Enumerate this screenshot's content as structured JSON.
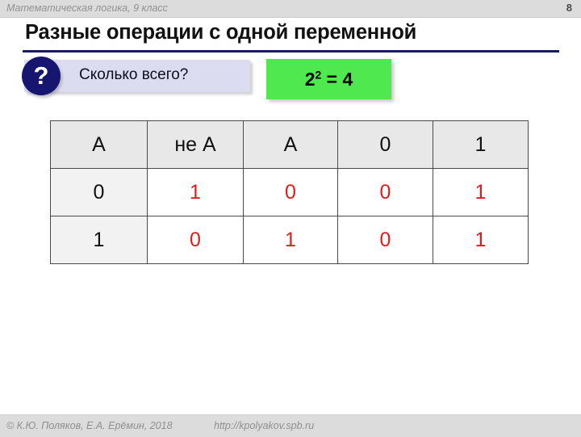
{
  "header": {
    "course_label": "Математическая логика, 9 класс",
    "page_number": "8"
  },
  "slide": {
    "title": "Разные операции с одной переменной",
    "rule_color": "#1a1a66"
  },
  "callout": {
    "icon_label": "?",
    "question": "Сколько всего?",
    "background": "#dcdcf0",
    "badge_color": "#161670"
  },
  "answer_box": {
    "base": "2",
    "exponent": "2",
    "equals": "= 4",
    "background": "#4fe84f"
  },
  "table": {
    "headers": [
      "A",
      "не A",
      "A",
      "0",
      "1"
    ],
    "rows": [
      {
        "input": "0",
        "values": [
          "1",
          "0",
          "0",
          "1"
        ]
      },
      {
        "input": "1",
        "values": [
          "0",
          "1",
          "0",
          "1"
        ]
      }
    ],
    "value_color": "#e01b1b",
    "header_background": "#e8e8e8"
  },
  "footer": {
    "copyright": "© К.Ю. Поляков, Е.А. Ерёмин, 2018",
    "url": "http://kpolyakov.spb.ru"
  }
}
